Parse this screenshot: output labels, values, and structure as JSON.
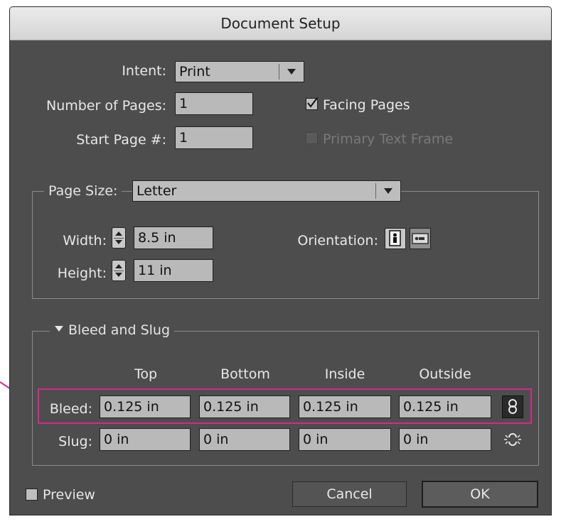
{
  "window": {
    "title": "Document Setup"
  },
  "intent": {
    "label": "Intent:",
    "value": "Print"
  },
  "pages": {
    "number_label": "Number of Pages:",
    "number_value": "1",
    "start_label": "Start Page #:",
    "start_value": "1",
    "facing_label": "Facing Pages",
    "facing_checked": true,
    "primary_label": "Primary Text Frame",
    "primary_checked": false
  },
  "page_size": {
    "label": "Page Size:",
    "value": "Letter",
    "width_label": "Width:",
    "width_value": "8.5 in",
    "height_label": "Height:",
    "height_value": "11 in",
    "orientation_label": "Orientation:",
    "orientation_selected": "portrait"
  },
  "bleed_slug": {
    "title": "Bleed and Slug",
    "columns": [
      "Top",
      "Bottom",
      "Inside",
      "Outside"
    ],
    "bleed_label": "Bleed:",
    "bleed_values": [
      "0.125 in",
      "0.125 in",
      "0.125 in",
      "0.125 in"
    ],
    "slug_label": "Slug:",
    "slug_values": [
      "0 in",
      "0 in",
      "0 in",
      "0 in"
    ],
    "bleed_link": "linked",
    "slug_link": "unlinked"
  },
  "footer": {
    "preview_label": "Preview",
    "preview_checked": false,
    "cancel_label": "Cancel",
    "ok_label": "OK"
  },
  "colors": {
    "dialog_bg": "#4d4d4d",
    "highlight": "#d6288a"
  },
  "icons": [
    "checkmark-icon",
    "dropdown-arrow-icon",
    "stepper-icon",
    "portrait-icon",
    "landscape-icon",
    "chain-linked-icon",
    "chain-broken-icon",
    "disclosure-triangle-icon"
  ]
}
